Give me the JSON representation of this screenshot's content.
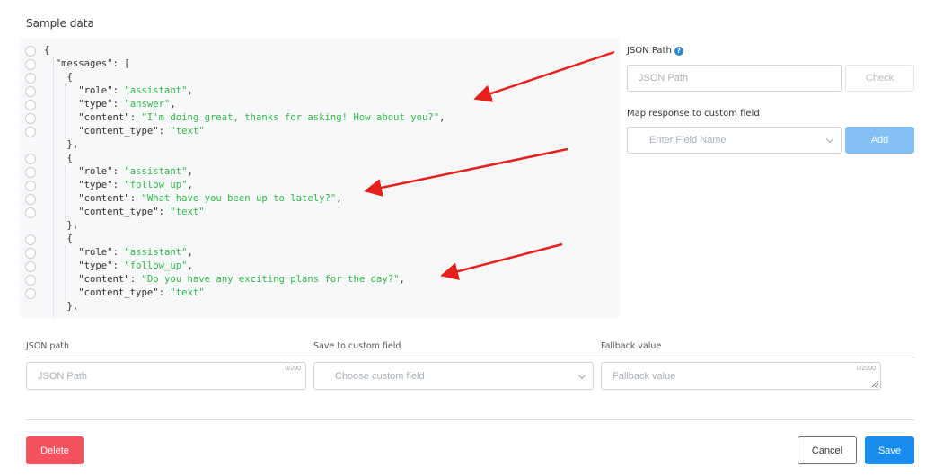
{
  "sample_data_title": "Sample data",
  "code_lines": [
    [
      [
        "p",
        "{"
      ]
    ],
    [
      [
        "p",
        "  "
      ],
      [
        "k",
        "\"messages\""
      ],
      [
        "p",
        ": ["
      ]
    ],
    [
      [
        "p",
        "    {"
      ]
    ],
    [
      [
        "p",
        "      "
      ],
      [
        "k",
        "\"role\""
      ],
      [
        "p",
        ": "
      ],
      [
        "s",
        "\"assistant\""
      ],
      [
        "p",
        ","
      ]
    ],
    [
      [
        "p",
        "      "
      ],
      [
        "k",
        "\"type\""
      ],
      [
        "p",
        ": "
      ],
      [
        "s",
        "\"answer\""
      ],
      [
        "p",
        ","
      ]
    ],
    [
      [
        "p",
        "      "
      ],
      [
        "k",
        "\"content\""
      ],
      [
        "p",
        ": "
      ],
      [
        "s",
        "\"I'm doing great, thanks for asking! How about you?\""
      ],
      [
        "p",
        ","
      ]
    ],
    [
      [
        "p",
        "      "
      ],
      [
        "k",
        "\"content_type\""
      ],
      [
        "p",
        ": "
      ],
      [
        "s",
        "\"text\""
      ]
    ],
    [
      [
        "p",
        "    },"
      ]
    ],
    [
      [
        "p",
        "    {"
      ]
    ],
    [
      [
        "p",
        "      "
      ],
      [
        "k",
        "\"role\""
      ],
      [
        "p",
        ": "
      ],
      [
        "s",
        "\"assistant\""
      ],
      [
        "p",
        ","
      ]
    ],
    [
      [
        "p",
        "      "
      ],
      [
        "k",
        "\"type\""
      ],
      [
        "p",
        ": "
      ],
      [
        "s",
        "\"follow_up\""
      ],
      [
        "p",
        ","
      ]
    ],
    [
      [
        "p",
        "      "
      ],
      [
        "k",
        "\"content\""
      ],
      [
        "p",
        ": "
      ],
      [
        "s",
        "\"What have you been up to lately?\""
      ],
      [
        "p",
        ","
      ]
    ],
    [
      [
        "p",
        "      "
      ],
      [
        "k",
        "\"content_type\""
      ],
      [
        "p",
        ": "
      ],
      [
        "s",
        "\"text\""
      ]
    ],
    [
      [
        "p",
        "    },"
      ]
    ],
    [
      [
        "p",
        "    {"
      ]
    ],
    [
      [
        "p",
        "      "
      ],
      [
        "k",
        "\"role\""
      ],
      [
        "p",
        ": "
      ],
      [
        "s",
        "\"assistant\""
      ],
      [
        "p",
        ","
      ]
    ],
    [
      [
        "p",
        "      "
      ],
      [
        "k",
        "\"type\""
      ],
      [
        "p",
        ": "
      ],
      [
        "s",
        "\"follow_up\""
      ],
      [
        "p",
        ","
      ]
    ],
    [
      [
        "p",
        "      "
      ],
      [
        "k",
        "\"content\""
      ],
      [
        "p",
        ": "
      ],
      [
        "s",
        "\"Do you have any exciting plans for the day?\""
      ],
      [
        "p",
        ","
      ]
    ],
    [
      [
        "p",
        "      "
      ],
      [
        "k",
        "\"content_type\""
      ],
      [
        "p",
        ": "
      ],
      [
        "s",
        "\"text\""
      ]
    ],
    [
      [
        "p",
        "    },"
      ]
    ]
  ],
  "radio_line_indexes": [
    0,
    1,
    2,
    3,
    4,
    5,
    6,
    8,
    9,
    10,
    11,
    12,
    14,
    15,
    16,
    17,
    18
  ],
  "right_panel": {
    "json_path_label": "JSON Path",
    "json_path_help_icon": "question-circle-icon",
    "json_path_placeholder": "JSON Path",
    "check_label": "Check",
    "map_label": "Map response to custom field",
    "field_name_placeholder": "Enter Field Name",
    "add_label": "Add"
  },
  "mapping_row": {
    "json_path_label": "JSON path",
    "json_path_placeholder": "JSON Path",
    "json_path_counter": "0/200",
    "custom_field_label": "Save to custom field",
    "custom_field_placeholder": "Choose custom field",
    "fallback_label": "Fallback value",
    "fallback_placeholder": "Fallback value",
    "fallback_counter": "0/2000"
  },
  "footer": {
    "delete_label": "Delete",
    "cancel_label": "Cancel",
    "save_label": "Save"
  },
  "colors": {
    "string_value": "#34b54a",
    "delete": "#f5515f",
    "save": "#1a8cf0",
    "add": "#82c0f5",
    "annotation_arrow": "#e8201c"
  }
}
